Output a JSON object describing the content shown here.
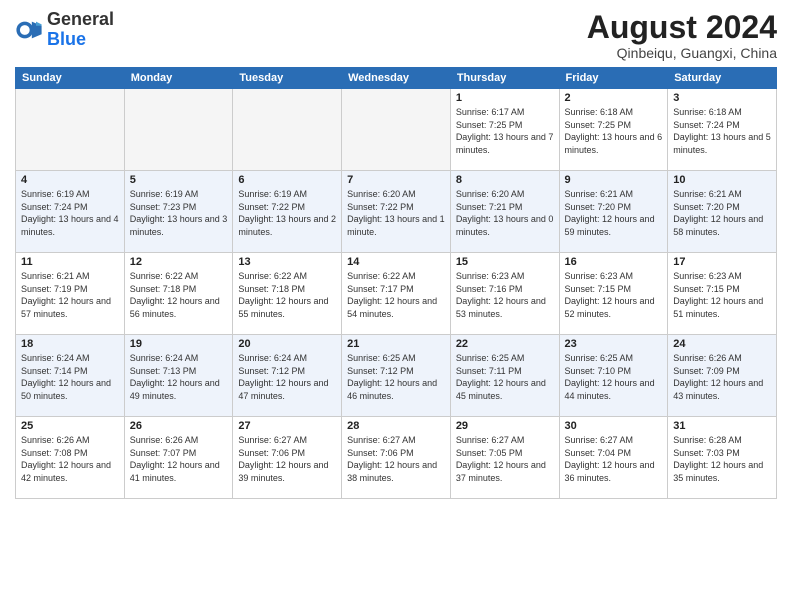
{
  "header": {
    "logo": {
      "general": "General",
      "blue": "Blue"
    },
    "title": "August 2024",
    "location": "Qinbeiqu, Guangxi, China"
  },
  "weekdays": [
    "Sunday",
    "Monday",
    "Tuesday",
    "Wednesday",
    "Thursday",
    "Friday",
    "Saturday"
  ],
  "weeks": [
    [
      {
        "day": "",
        "empty": true
      },
      {
        "day": "",
        "empty": true
      },
      {
        "day": "",
        "empty": true
      },
      {
        "day": "",
        "empty": true
      },
      {
        "day": "1",
        "sunrise": "6:17 AM",
        "sunset": "7:25 PM",
        "daylight": "13 hours and 7 minutes."
      },
      {
        "day": "2",
        "sunrise": "6:18 AM",
        "sunset": "7:25 PM",
        "daylight": "13 hours and 6 minutes."
      },
      {
        "day": "3",
        "sunrise": "6:18 AM",
        "sunset": "7:24 PM",
        "daylight": "13 hours and 5 minutes."
      }
    ],
    [
      {
        "day": "4",
        "sunrise": "6:19 AM",
        "sunset": "7:24 PM",
        "daylight": "13 hours and 4 minutes."
      },
      {
        "day": "5",
        "sunrise": "6:19 AM",
        "sunset": "7:23 PM",
        "daylight": "13 hours and 3 minutes."
      },
      {
        "day": "6",
        "sunrise": "6:19 AM",
        "sunset": "7:22 PM",
        "daylight": "13 hours and 2 minutes."
      },
      {
        "day": "7",
        "sunrise": "6:20 AM",
        "sunset": "7:22 PM",
        "daylight": "13 hours and 1 minute."
      },
      {
        "day": "8",
        "sunrise": "6:20 AM",
        "sunset": "7:21 PM",
        "daylight": "13 hours and 0 minutes."
      },
      {
        "day": "9",
        "sunrise": "6:21 AM",
        "sunset": "7:20 PM",
        "daylight": "12 hours and 59 minutes."
      },
      {
        "day": "10",
        "sunrise": "6:21 AM",
        "sunset": "7:20 PM",
        "daylight": "12 hours and 58 minutes."
      }
    ],
    [
      {
        "day": "11",
        "sunrise": "6:21 AM",
        "sunset": "7:19 PM",
        "daylight": "12 hours and 57 minutes."
      },
      {
        "day": "12",
        "sunrise": "6:22 AM",
        "sunset": "7:18 PM",
        "daylight": "12 hours and 56 minutes."
      },
      {
        "day": "13",
        "sunrise": "6:22 AM",
        "sunset": "7:18 PM",
        "daylight": "12 hours and 55 minutes."
      },
      {
        "day": "14",
        "sunrise": "6:22 AM",
        "sunset": "7:17 PM",
        "daylight": "12 hours and 54 minutes."
      },
      {
        "day": "15",
        "sunrise": "6:23 AM",
        "sunset": "7:16 PM",
        "daylight": "12 hours and 53 minutes."
      },
      {
        "day": "16",
        "sunrise": "6:23 AM",
        "sunset": "7:15 PM",
        "daylight": "12 hours and 52 minutes."
      },
      {
        "day": "17",
        "sunrise": "6:23 AM",
        "sunset": "7:15 PM",
        "daylight": "12 hours and 51 minutes."
      }
    ],
    [
      {
        "day": "18",
        "sunrise": "6:24 AM",
        "sunset": "7:14 PM",
        "daylight": "12 hours and 50 minutes."
      },
      {
        "day": "19",
        "sunrise": "6:24 AM",
        "sunset": "7:13 PM",
        "daylight": "12 hours and 49 minutes."
      },
      {
        "day": "20",
        "sunrise": "6:24 AM",
        "sunset": "7:12 PM",
        "daylight": "12 hours and 47 minutes."
      },
      {
        "day": "21",
        "sunrise": "6:25 AM",
        "sunset": "7:12 PM",
        "daylight": "12 hours and 46 minutes."
      },
      {
        "day": "22",
        "sunrise": "6:25 AM",
        "sunset": "7:11 PM",
        "daylight": "12 hours and 45 minutes."
      },
      {
        "day": "23",
        "sunrise": "6:25 AM",
        "sunset": "7:10 PM",
        "daylight": "12 hours and 44 minutes."
      },
      {
        "day": "24",
        "sunrise": "6:26 AM",
        "sunset": "7:09 PM",
        "daylight": "12 hours and 43 minutes."
      }
    ],
    [
      {
        "day": "25",
        "sunrise": "6:26 AM",
        "sunset": "7:08 PM",
        "daylight": "12 hours and 42 minutes."
      },
      {
        "day": "26",
        "sunrise": "6:26 AM",
        "sunset": "7:07 PM",
        "daylight": "12 hours and 41 minutes."
      },
      {
        "day": "27",
        "sunrise": "6:27 AM",
        "sunset": "7:06 PM",
        "daylight": "12 hours and 39 minutes."
      },
      {
        "day": "28",
        "sunrise": "6:27 AM",
        "sunset": "7:06 PM",
        "daylight": "12 hours and 38 minutes."
      },
      {
        "day": "29",
        "sunrise": "6:27 AM",
        "sunset": "7:05 PM",
        "daylight": "12 hours and 37 minutes."
      },
      {
        "day": "30",
        "sunrise": "6:27 AM",
        "sunset": "7:04 PM",
        "daylight": "12 hours and 36 minutes."
      },
      {
        "day": "31",
        "sunrise": "6:28 AM",
        "sunset": "7:03 PM",
        "daylight": "12 hours and 35 minutes."
      }
    ]
  ]
}
